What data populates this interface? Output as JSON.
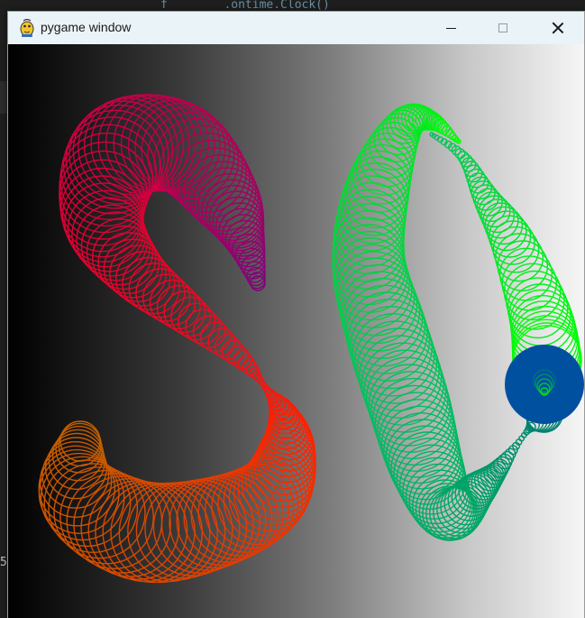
{
  "window": {
    "title": "pygame window",
    "icon": "pygame-snake-icon",
    "buttons": {
      "minimize": "minimize-icon",
      "maximize": "maximize-icon",
      "close": "close-icon"
    }
  },
  "background_editor": {
    "snippet": "f        .ontime.Clock()",
    "gutter_digit": "5"
  },
  "canvas": {
    "background_gradient": [
      "#000000",
      "#f6f6f6"
    ],
    "colors": {
      "s_start": "#800080",
      "s_mid": "#e00030",
      "s_end": "#ff2000",
      "s_tail": "#c06000",
      "s2_start": "#00ff00",
      "s2_mid": "#00c060",
      "s2_end": "#008070",
      "blue_ball": "#0050a0"
    }
  }
}
